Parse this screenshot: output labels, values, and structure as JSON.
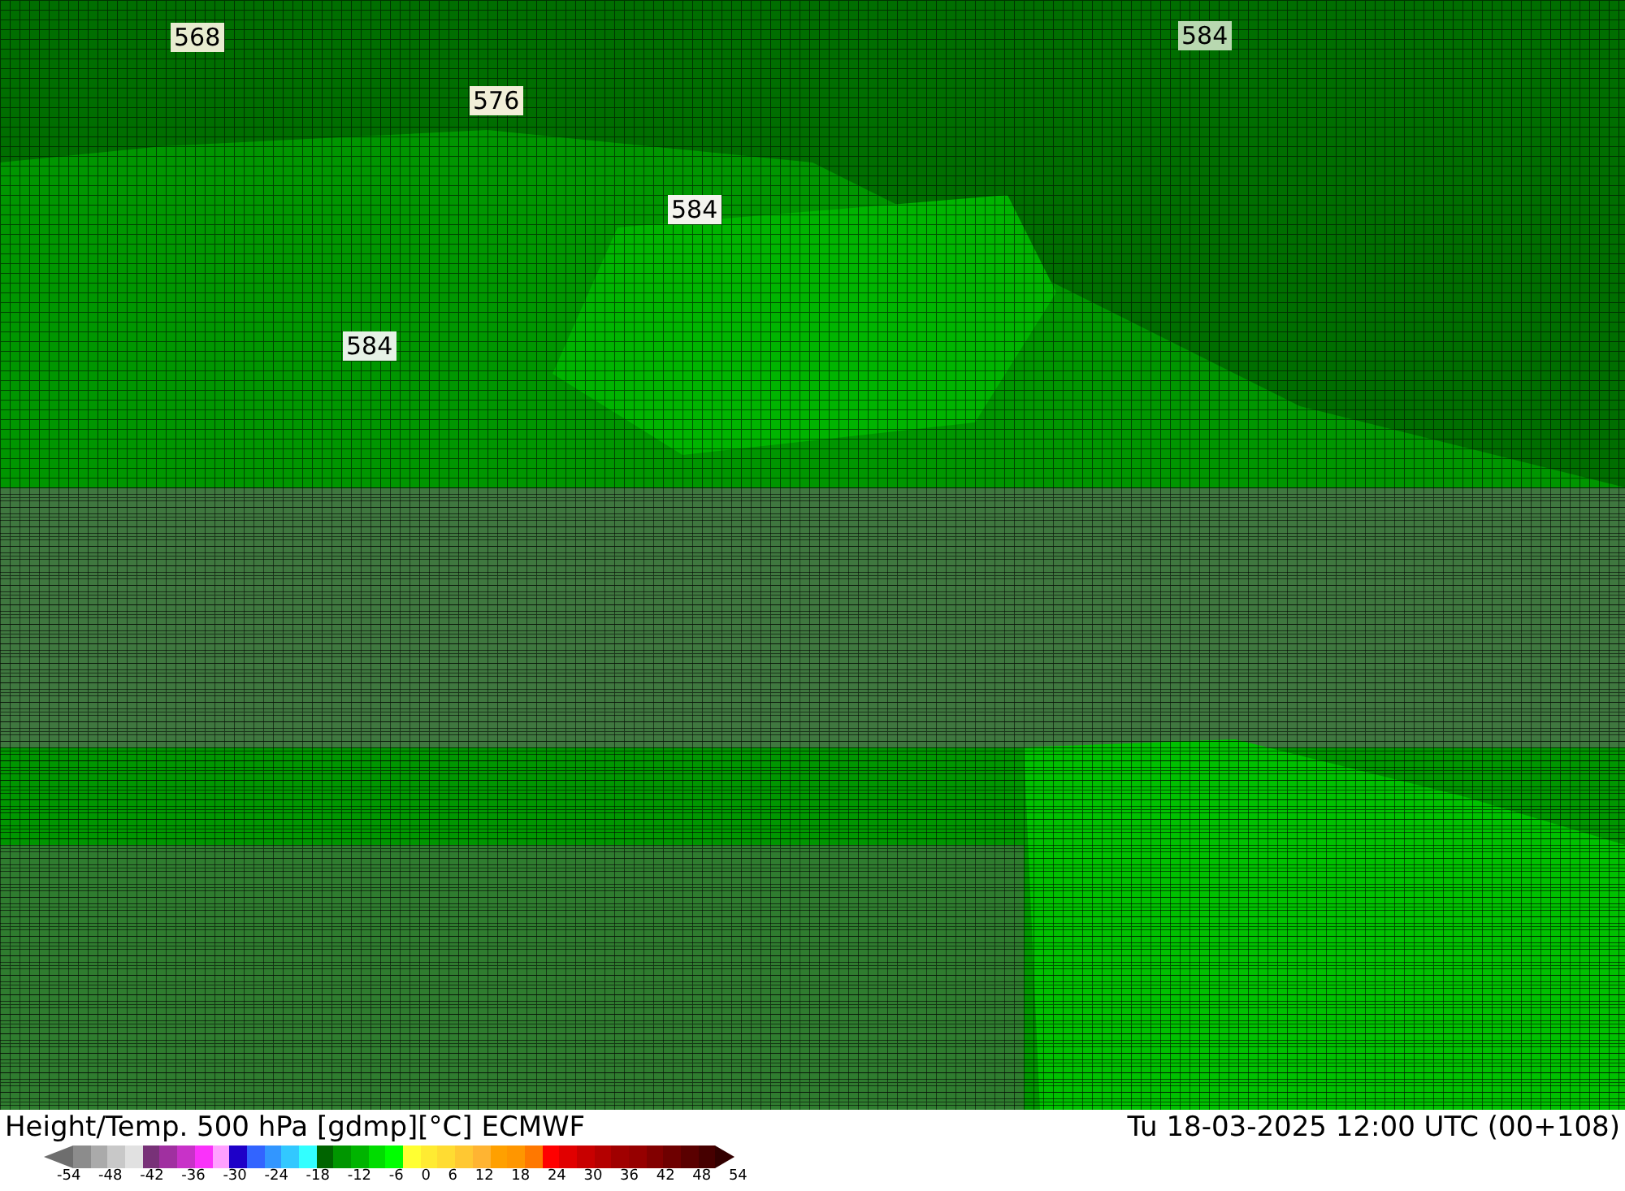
{
  "map": {
    "contour_labels": [
      {
        "text": "568"
      },
      {
        "text": "576"
      },
      {
        "text": "584"
      },
      {
        "text": "584"
      },
      {
        "text": "584"
      }
    ]
  },
  "footer": {
    "title": "Height/Temp. 500 hPa [gdmp][°C] ECMWF",
    "valid_time": "Tu 18-03-2025 12:00 UTC (00+108)"
  },
  "legend": {
    "swatches": [
      {
        "kind": "arrow-left",
        "color": "#6e6e6e"
      },
      {
        "kind": "box",
        "color": "#8c8c8c"
      },
      {
        "kind": "box",
        "color": "#aaaaaa"
      },
      {
        "kind": "box",
        "color": "#c8c8c8"
      },
      {
        "kind": "box",
        "color": "#e1e1e1"
      },
      {
        "kind": "box",
        "color": "#783278"
      },
      {
        "kind": "box",
        "color": "#a030a0"
      },
      {
        "kind": "box",
        "color": "#c832c8"
      },
      {
        "kind": "box",
        "color": "#fa32fa"
      },
      {
        "kind": "box",
        "color": "#ffa0ff"
      },
      {
        "kind": "box",
        "color": "#1e00c8"
      },
      {
        "kind": "box",
        "color": "#3264ff"
      },
      {
        "kind": "box",
        "color": "#3296ff"
      },
      {
        "kind": "box",
        "color": "#32c8ff"
      },
      {
        "kind": "box",
        "color": "#32ffff"
      },
      {
        "kind": "box",
        "color": "#006400"
      },
      {
        "kind": "box",
        "color": "#009600"
      },
      {
        "kind": "box",
        "color": "#00b400"
      },
      {
        "kind": "box",
        "color": "#00dc00"
      },
      {
        "kind": "box",
        "color": "#00ff00"
      },
      {
        "kind": "box",
        "color": "#ffff32"
      },
      {
        "kind": "box",
        "color": "#ffeb32"
      },
      {
        "kind": "box",
        "color": "#ffdc32"
      },
      {
        "kind": "box",
        "color": "#ffc832"
      },
      {
        "kind": "box",
        "color": "#ffb432"
      },
      {
        "kind": "box",
        "color": "#ffa000"
      },
      {
        "kind": "box",
        "color": "#ff9600"
      },
      {
        "kind": "box",
        "color": "#ff7800"
      },
      {
        "kind": "box",
        "color": "#ff0000"
      },
      {
        "kind": "box",
        "color": "#e10000"
      },
      {
        "kind": "box",
        "color": "#c80000"
      },
      {
        "kind": "box",
        "color": "#b40000"
      },
      {
        "kind": "box",
        "color": "#a00000"
      },
      {
        "kind": "box",
        "color": "#960000"
      },
      {
        "kind": "box",
        "color": "#820000"
      },
      {
        "kind": "box",
        "color": "#6e0000"
      },
      {
        "kind": "box",
        "color": "#5a0000"
      },
      {
        "kind": "box",
        "color": "#460000"
      },
      {
        "kind": "arrow-right",
        "color": "#320000"
      }
    ],
    "ticks": [
      "-54",
      "-48",
      "-42",
      "-36",
      "-30",
      "-24",
      "-18",
      "-12",
      "-6",
      "0",
      "6",
      "12",
      "18",
      "24",
      "30",
      "36",
      "42",
      "48",
      "54"
    ]
  }
}
